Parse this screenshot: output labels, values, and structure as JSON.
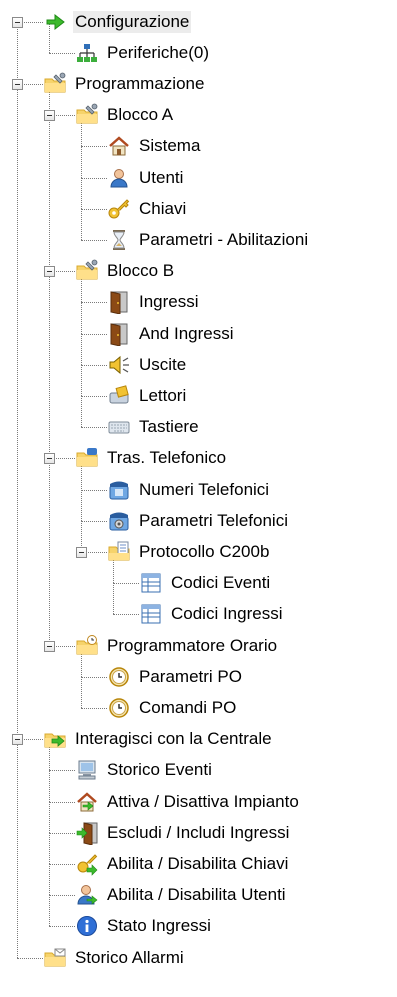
{
  "tree": {
    "root": [
      {
        "label": "Configurazione",
        "icon": "green-arrow-icon",
        "selected": true,
        "children": [
          {
            "label": "Periferiche(0)",
            "icon": "network-icon"
          }
        ]
      },
      {
        "label": "Programmazione",
        "icon": "folder-wrench-icon",
        "children": [
          {
            "label": "Blocco A",
            "icon": "folder-wrench-icon",
            "children": [
              {
                "label": "Sistema",
                "icon": "house-icon"
              },
              {
                "label": "Utenti",
                "icon": "user-icon"
              },
              {
                "label": "Chiavi",
                "icon": "key-icon"
              },
              {
                "label": "Parametri - Abilitazioni",
                "icon": "hourglass-icon"
              }
            ]
          },
          {
            "label": "Blocco B",
            "icon": "folder-wrench-icon",
            "children": [
              {
                "label": "Ingressi",
                "icon": "door-icon"
              },
              {
                "label": "And Ingressi",
                "icon": "door-icon"
              },
              {
                "label": "Uscite",
                "icon": "speaker-icon"
              },
              {
                "label": "Lettori",
                "icon": "card-reader-icon"
              },
              {
                "label": "Tastiere",
                "icon": "keyboard-icon"
              }
            ]
          },
          {
            "label": "Tras. Telefonico",
            "icon": "folder-phone-icon",
            "children": [
              {
                "label": "Numeri Telefonici",
                "icon": "phone-icon"
              },
              {
                "label": "Parametri Telefonici",
                "icon": "phone-gear-icon"
              },
              {
                "label": "Protocollo C200b",
                "icon": "folder-docs-icon",
                "children": [
                  {
                    "label": "Codici Eventi",
                    "icon": "table-icon"
                  },
                  {
                    "label": "Codici Ingressi",
                    "icon": "table-icon"
                  }
                ]
              }
            ]
          },
          {
            "label": "Programmatore Orario",
            "icon": "folder-clock-icon",
            "children": [
              {
                "label": "Parametri PO",
                "icon": "clock-icon"
              },
              {
                "label": "Comandi PO",
                "icon": "clock-icon"
              }
            ]
          }
        ]
      },
      {
        "label": "Interagisci con la Centrale",
        "icon": "folder-green-arrow-icon",
        "children": [
          {
            "label": "Storico Eventi",
            "icon": "computer-icon"
          },
          {
            "label": "Attiva / Disattiva Impianto",
            "icon": "house-arrow-icon"
          },
          {
            "label": "Escludi / Includi Ingressi",
            "icon": "door-arrow-icon"
          },
          {
            "label": "Abilita / Disabilita Chiavi",
            "icon": "key-arrow-icon"
          },
          {
            "label": "Abilita / Disabilita Utenti",
            "icon": "user-arrow-icon"
          },
          {
            "label": "Stato Ingressi",
            "icon": "info-icon"
          }
        ]
      },
      {
        "label": "Storico Allarmi",
        "icon": "folder-envelope-icon"
      }
    ]
  },
  "colors": {
    "folder": "#f6d36b",
    "folder_dark": "#d9a92d",
    "green": "#3cba2c",
    "blue": "#3a78c8",
    "selection": "#ececec"
  }
}
